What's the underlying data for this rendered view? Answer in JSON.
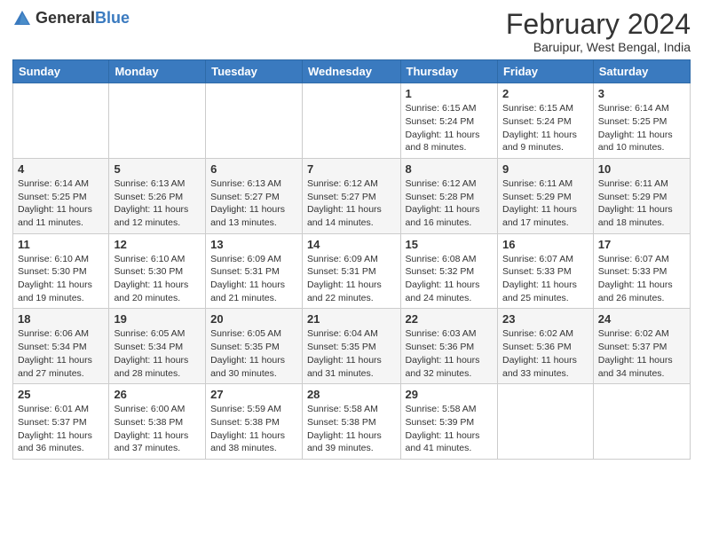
{
  "header": {
    "logo_general": "General",
    "logo_blue": "Blue",
    "title": "February 2024",
    "subtitle": "Baruipur, West Bengal, India"
  },
  "weekdays": [
    "Sunday",
    "Monday",
    "Tuesday",
    "Wednesday",
    "Thursday",
    "Friday",
    "Saturday"
  ],
  "weeks": [
    [
      {
        "day": "",
        "info": ""
      },
      {
        "day": "",
        "info": ""
      },
      {
        "day": "",
        "info": ""
      },
      {
        "day": "",
        "info": ""
      },
      {
        "day": "1",
        "info": "Sunrise: 6:15 AM\nSunset: 5:24 PM\nDaylight: 11 hours and 8 minutes."
      },
      {
        "day": "2",
        "info": "Sunrise: 6:15 AM\nSunset: 5:24 PM\nDaylight: 11 hours and 9 minutes."
      },
      {
        "day": "3",
        "info": "Sunrise: 6:14 AM\nSunset: 5:25 PM\nDaylight: 11 hours and 10 minutes."
      }
    ],
    [
      {
        "day": "4",
        "info": "Sunrise: 6:14 AM\nSunset: 5:25 PM\nDaylight: 11 hours and 11 minutes."
      },
      {
        "day": "5",
        "info": "Sunrise: 6:13 AM\nSunset: 5:26 PM\nDaylight: 11 hours and 12 minutes."
      },
      {
        "day": "6",
        "info": "Sunrise: 6:13 AM\nSunset: 5:27 PM\nDaylight: 11 hours and 13 minutes."
      },
      {
        "day": "7",
        "info": "Sunrise: 6:12 AM\nSunset: 5:27 PM\nDaylight: 11 hours and 14 minutes."
      },
      {
        "day": "8",
        "info": "Sunrise: 6:12 AM\nSunset: 5:28 PM\nDaylight: 11 hours and 16 minutes."
      },
      {
        "day": "9",
        "info": "Sunrise: 6:11 AM\nSunset: 5:29 PM\nDaylight: 11 hours and 17 minutes."
      },
      {
        "day": "10",
        "info": "Sunrise: 6:11 AM\nSunset: 5:29 PM\nDaylight: 11 hours and 18 minutes."
      }
    ],
    [
      {
        "day": "11",
        "info": "Sunrise: 6:10 AM\nSunset: 5:30 PM\nDaylight: 11 hours and 19 minutes."
      },
      {
        "day": "12",
        "info": "Sunrise: 6:10 AM\nSunset: 5:30 PM\nDaylight: 11 hours and 20 minutes."
      },
      {
        "day": "13",
        "info": "Sunrise: 6:09 AM\nSunset: 5:31 PM\nDaylight: 11 hours and 21 minutes."
      },
      {
        "day": "14",
        "info": "Sunrise: 6:09 AM\nSunset: 5:31 PM\nDaylight: 11 hours and 22 minutes."
      },
      {
        "day": "15",
        "info": "Sunrise: 6:08 AM\nSunset: 5:32 PM\nDaylight: 11 hours and 24 minutes."
      },
      {
        "day": "16",
        "info": "Sunrise: 6:07 AM\nSunset: 5:33 PM\nDaylight: 11 hours and 25 minutes."
      },
      {
        "day": "17",
        "info": "Sunrise: 6:07 AM\nSunset: 5:33 PM\nDaylight: 11 hours and 26 minutes."
      }
    ],
    [
      {
        "day": "18",
        "info": "Sunrise: 6:06 AM\nSunset: 5:34 PM\nDaylight: 11 hours and 27 minutes."
      },
      {
        "day": "19",
        "info": "Sunrise: 6:05 AM\nSunset: 5:34 PM\nDaylight: 11 hours and 28 minutes."
      },
      {
        "day": "20",
        "info": "Sunrise: 6:05 AM\nSunset: 5:35 PM\nDaylight: 11 hours and 30 minutes."
      },
      {
        "day": "21",
        "info": "Sunrise: 6:04 AM\nSunset: 5:35 PM\nDaylight: 11 hours and 31 minutes."
      },
      {
        "day": "22",
        "info": "Sunrise: 6:03 AM\nSunset: 5:36 PM\nDaylight: 11 hours and 32 minutes."
      },
      {
        "day": "23",
        "info": "Sunrise: 6:02 AM\nSunset: 5:36 PM\nDaylight: 11 hours and 33 minutes."
      },
      {
        "day": "24",
        "info": "Sunrise: 6:02 AM\nSunset: 5:37 PM\nDaylight: 11 hours and 34 minutes."
      }
    ],
    [
      {
        "day": "25",
        "info": "Sunrise: 6:01 AM\nSunset: 5:37 PM\nDaylight: 11 hours and 36 minutes."
      },
      {
        "day": "26",
        "info": "Sunrise: 6:00 AM\nSunset: 5:38 PM\nDaylight: 11 hours and 37 minutes."
      },
      {
        "day": "27",
        "info": "Sunrise: 5:59 AM\nSunset: 5:38 PM\nDaylight: 11 hours and 38 minutes."
      },
      {
        "day": "28",
        "info": "Sunrise: 5:58 AM\nSunset: 5:38 PM\nDaylight: 11 hours and 39 minutes."
      },
      {
        "day": "29",
        "info": "Sunrise: 5:58 AM\nSunset: 5:39 PM\nDaylight: 11 hours and 41 minutes."
      },
      {
        "day": "",
        "info": ""
      },
      {
        "day": "",
        "info": ""
      }
    ]
  ]
}
